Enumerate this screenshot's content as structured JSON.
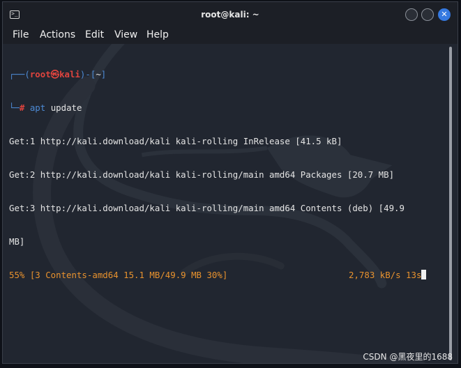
{
  "window": {
    "title": "root@kali: ~",
    "close_glyph": "✕"
  },
  "menu": [
    "File",
    "Actions",
    "Edit",
    "View",
    "Help"
  ],
  "prompt": {
    "open": "┌──(",
    "user": "root㉿kali",
    "mid": ")-[",
    "dir": "~",
    "close": "]",
    "second_prefix": "└─",
    "hash": "#",
    "command": " apt",
    "args": " update"
  },
  "output": [
    "Get:1 http://kali.download/kali kali-rolling InRelease [41.5 kB]",
    "Get:2 http://kali.download/kali kali-rolling/main amd64 Packages [20.7 MB]",
    "Get:3 http://kali.download/kali kali-rolling/main amd64 Contents (deb) [49.9",
    "MB]"
  ],
  "progress": {
    "left": "55% [3 Contents-amd64 15.1 MB/49.9 MB 30%]",
    "right": "2,783 kB/s 13s"
  },
  "watermark": "CSDN @黑夜里的1688",
  "icons": [
    "terminal-app-icon",
    "minimize-icon",
    "maximize-icon",
    "close-icon",
    "kali-dragon-logo"
  ],
  "colors": {
    "prompt_blue": "#4d8bd6",
    "prompt_red": "#e0443e",
    "progress_orange": "#e8922e",
    "close_button": "#3579e0"
  }
}
